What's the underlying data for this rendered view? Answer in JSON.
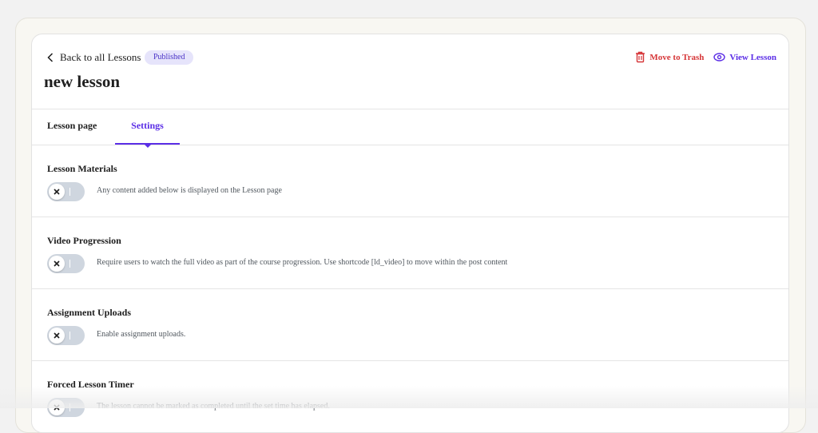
{
  "header": {
    "back_label": "Back to all Lessons",
    "status_badge": "Published",
    "title": "new lesson",
    "trash_label": "Move to Trash",
    "view_label": "View Lesson"
  },
  "tabs": [
    {
      "label": "Lesson page",
      "active": false
    },
    {
      "label": "Settings",
      "active": true
    }
  ],
  "sections": [
    {
      "title": "Lesson Materials",
      "description": "Any content added below is displayed on the Lesson page",
      "enabled": false
    },
    {
      "title": "Video Progression",
      "description": "Require users to watch the full video as part of the course progression. Use shortcode [ld_video] to move within the post content",
      "enabled": false
    },
    {
      "title": "Assignment Uploads",
      "description": "Enable assignment uploads.",
      "enabled": false
    },
    {
      "title": "Forced Lesson Timer",
      "description": "The lesson cannot be marked as completed until the set time has elapsed.",
      "enabled": false
    }
  ],
  "colors": {
    "accent": "#5b2ee6",
    "danger": "#d63638",
    "badge_bg": "#e6e4fb"
  },
  "icons": {
    "back": "chevron-left-icon",
    "trash": "trash-icon",
    "view": "eye-icon",
    "toggle_off": "x-icon"
  }
}
